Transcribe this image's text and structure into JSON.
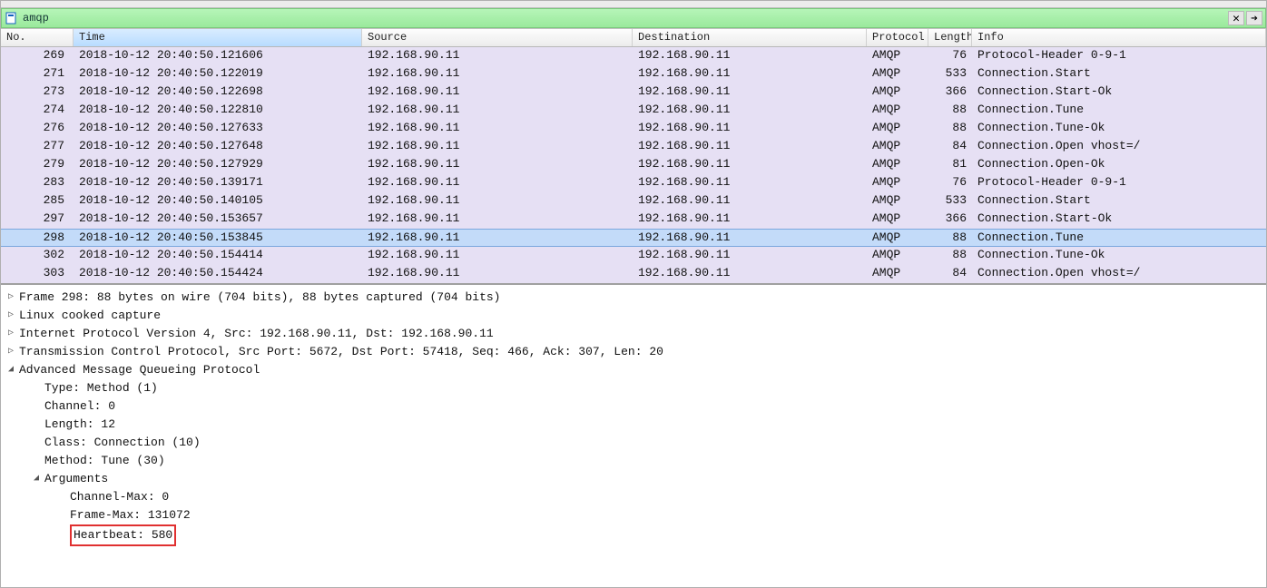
{
  "filter": {
    "value": "amqp"
  },
  "columns": {
    "no": "No.",
    "time": "Time",
    "source": "Source",
    "destination": "Destination",
    "protocol": "Protocol",
    "length": "Length",
    "info": "Info"
  },
  "packets": [
    {
      "no": "269",
      "time": "2018-10-12 20:40:50.121606",
      "src": "192.168.90.11",
      "dst": "192.168.90.11",
      "proto": "AMQP",
      "len": "76",
      "info": "Protocol-Header 0-9-1"
    },
    {
      "no": "271",
      "time": "2018-10-12 20:40:50.122019",
      "src": "192.168.90.11",
      "dst": "192.168.90.11",
      "proto": "AMQP",
      "len": "533",
      "info": "Connection.Start"
    },
    {
      "no": "273",
      "time": "2018-10-12 20:40:50.122698",
      "src": "192.168.90.11",
      "dst": "192.168.90.11",
      "proto": "AMQP",
      "len": "366",
      "info": "Connection.Start-Ok"
    },
    {
      "no": "274",
      "time": "2018-10-12 20:40:50.122810",
      "src": "192.168.90.11",
      "dst": "192.168.90.11",
      "proto": "AMQP",
      "len": "88",
      "info": "Connection.Tune"
    },
    {
      "no": "276",
      "time": "2018-10-12 20:40:50.127633",
      "src": "192.168.90.11",
      "dst": "192.168.90.11",
      "proto": "AMQP",
      "len": "88",
      "info": "Connection.Tune-Ok"
    },
    {
      "no": "277",
      "time": "2018-10-12 20:40:50.127648",
      "src": "192.168.90.11",
      "dst": "192.168.90.11",
      "proto": "AMQP",
      "len": "84",
      "info": "Connection.Open vhost=/"
    },
    {
      "no": "279",
      "time": "2018-10-12 20:40:50.127929",
      "src": "192.168.90.11",
      "dst": "192.168.90.11",
      "proto": "AMQP",
      "len": "81",
      "info": "Connection.Open-Ok"
    },
    {
      "no": "283",
      "time": "2018-10-12 20:40:50.139171",
      "src": "192.168.90.11",
      "dst": "192.168.90.11",
      "proto": "AMQP",
      "len": "76",
      "info": "Protocol-Header 0-9-1"
    },
    {
      "no": "285",
      "time": "2018-10-12 20:40:50.140105",
      "src": "192.168.90.11",
      "dst": "192.168.90.11",
      "proto": "AMQP",
      "len": "533",
      "info": "Connection.Start"
    },
    {
      "no": "297",
      "time": "2018-10-12 20:40:50.153657",
      "src": "192.168.90.11",
      "dst": "192.168.90.11",
      "proto": "AMQP",
      "len": "366",
      "info": "Connection.Start-Ok"
    },
    {
      "no": "298",
      "time": "2018-10-12 20:40:50.153845",
      "src": "192.168.90.11",
      "dst": "192.168.90.11",
      "proto": "AMQP",
      "len": "88",
      "info": "Connection.Tune",
      "selected": true
    },
    {
      "no": "302",
      "time": "2018-10-12 20:40:50.154414",
      "src": "192.168.90.11",
      "dst": "192.168.90.11",
      "proto": "AMQP",
      "len": "88",
      "info": "Connection.Tune-Ok"
    },
    {
      "no": "303",
      "time": "2018-10-12 20:40:50.154424",
      "src": "192.168.90.11",
      "dst": "192.168.90.11",
      "proto": "AMQP",
      "len": "84",
      "info": "Connection.Open vhost=/"
    }
  ],
  "details": {
    "frame": "Frame 298: 88 bytes on wire (704 bits), 88 bytes captured (704 bits)",
    "linux_cooked": "Linux cooked capture",
    "ip": "Internet Protocol Version 4, Src: 192.168.90.11, Dst: 192.168.90.11",
    "tcp": "Transmission Control Protocol, Src Port: 5672, Dst Port: 57418, Seq: 466, Ack: 307, Len: 20",
    "amqp_title": "Advanced Message Queueing Protocol",
    "amqp_type": "Type: Method (1)",
    "amqp_channel": "Channel: 0",
    "amqp_length": "Length: 12",
    "amqp_class": "Class: Connection (10)",
    "amqp_method": "Method: Tune (30)",
    "amqp_args_title": "Arguments",
    "amqp_arg_channel_max": "Channel-Max: 0",
    "amqp_arg_frame_max": "Frame-Max: 131072",
    "amqp_arg_heartbeat": "Heartbeat: 580"
  },
  "glyphs": {
    "closed": "▷",
    "open": "◢"
  },
  "icons": {
    "clear": "✕",
    "arrow": "➔"
  }
}
